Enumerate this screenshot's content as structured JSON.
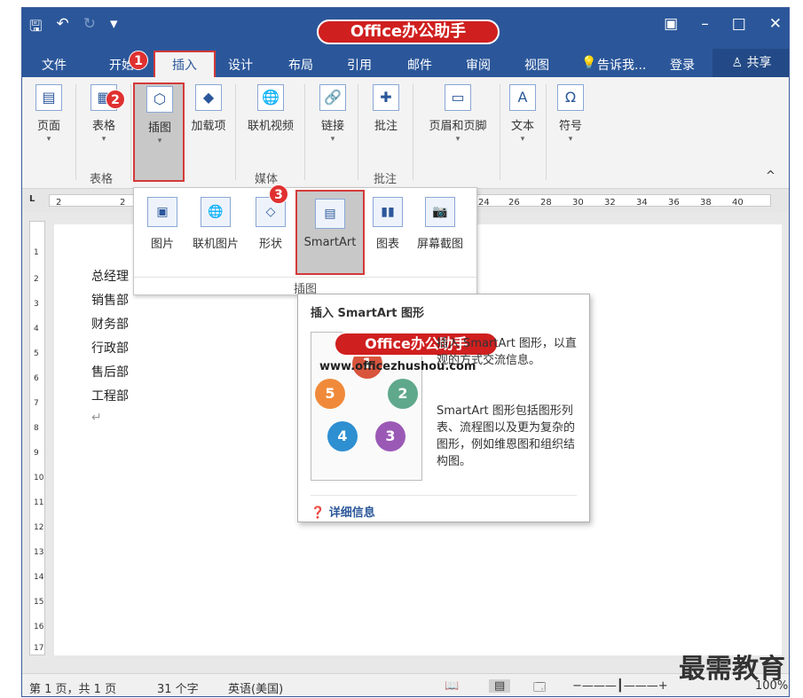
{
  "brand": "Office办公助手",
  "watermark_url": "www.officezhushou.com",
  "corner_watermark": "最需教育",
  "tabs": [
    "文件",
    "开始",
    "插入",
    "设计",
    "布局",
    "引用",
    "邮件",
    "审阅",
    "视图"
  ],
  "tell_me": "告诉我...",
  "login": "登录",
  "share": "共享",
  "ribbon": {
    "page": "页面",
    "table": "表格",
    "illustrations": "插图",
    "addins": "加载项",
    "online_video": "联机视频",
    "link": "链接",
    "comment": "批注",
    "header_footer": "页眉和页脚",
    "text": "文本",
    "symbol": "符号",
    "group_table": "表格",
    "group_media": "媒体",
    "group_comment": "批注"
  },
  "gallery": {
    "picture": "图片",
    "online_picture": "联机图片",
    "shapes": "形状",
    "smartart": "SmartArt",
    "chart": "图表",
    "screenshot": "屏幕截图",
    "footer": "插图"
  },
  "badges": [
    "1",
    "2",
    "3"
  ],
  "ruler": [
    "2",
    "2",
    "24",
    "26",
    "28",
    "30",
    "32",
    "34",
    "36",
    "38",
    "40"
  ],
  "doc_lines": [
    "总经理",
    "销售部",
    "财务部",
    "行政部",
    "售后部",
    "工程部"
  ],
  "tooltip": {
    "title": "插入 SmartArt 图形",
    "text1": "插入 SmartArt 图形，以直观的方式交流信息。",
    "text2": "SmartArt 图形包括图形列表、流程图以及更为复杂的图形，例如维恩图和组织结构图。",
    "more": "详细信息",
    "circles": [
      "1",
      "2",
      "3",
      "4",
      "5"
    ]
  },
  "status": {
    "page": "第 1 页，共 1 页",
    "words": "31 个字",
    "lang": "英语(美国)",
    "zoom": "100%"
  },
  "colors": {
    "accent": "#2b579a",
    "highlight": "#d43a3a"
  }
}
